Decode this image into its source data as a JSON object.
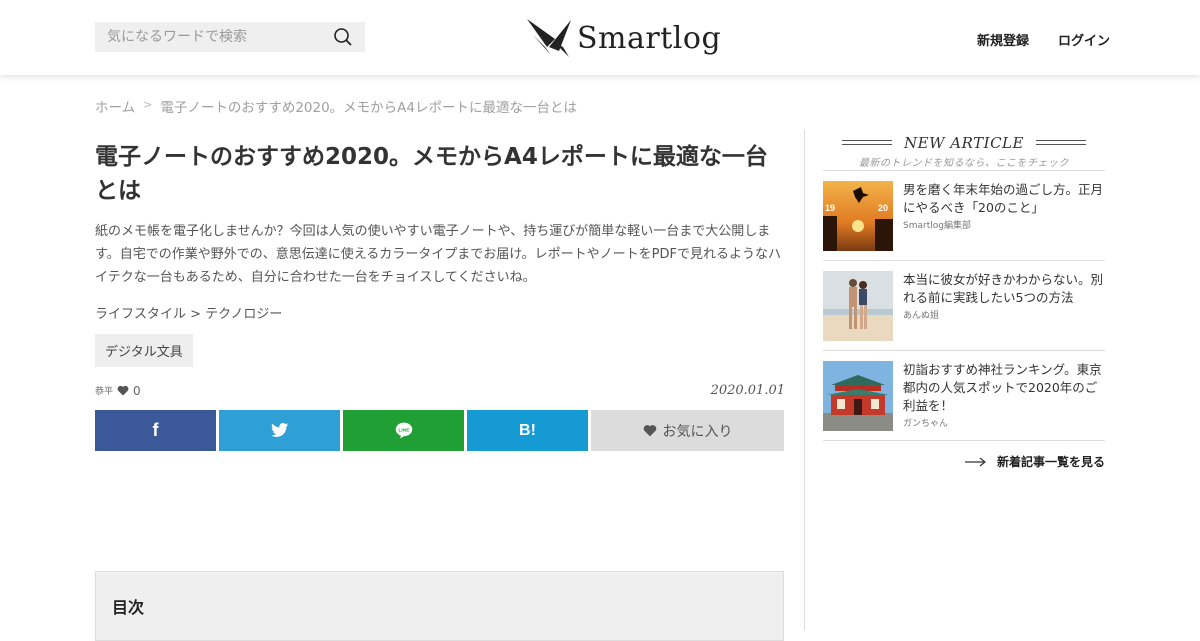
{
  "header": {
    "search_placeholder": "気になるワードで検索",
    "logo_text": "Smartlog",
    "register_label": "新規登録",
    "login_label": "ログイン"
  },
  "breadcrumb": {
    "home": "ホーム",
    "separator": ">",
    "current": "電子ノートのおすすめ2020。メモからA4レポートに最適な一台とは"
  },
  "article": {
    "title": "電子ノートのおすすめ2020。メモからA4レポートに最適な一台とは",
    "description": "紙のメモ帳を電子化しませんか？今回は人気の使いやすい電子ノートや、持ち運びが簡単な軽い一台まで大公開します。自宅での作業や野外での、意思伝達に使えるカラータイプまでお届け。レポートやノートをPDFで見れるようなハイテクな一台もあるため、自分に合わせた一台をチョイスしてくださいね。",
    "category": "ライフスタイル > テクノロジー",
    "tag": "デジタル文具",
    "author_short": "恭平",
    "like_count": "0",
    "date": "2020.01.01"
  },
  "share": {
    "facebook_icon": "f",
    "hatena_label": "B!",
    "favorite_label": "お気に入り"
  },
  "toc": {
    "title": "目次"
  },
  "sidebar": {
    "heading_en": "NEW ARTICLE",
    "heading_jp": "最新のトレンドを知るなら、ここをチェック",
    "articles": [
      {
        "title": "男を磨く年末年始の過ごし方。正月にやるべき「20のこと」",
        "author": "Smartlog編集部",
        "thumb": "sunset-2020-jump"
      },
      {
        "title": "本当に彼女が好きかわからない。別れる前に実践したい5つの方法",
        "author": "あんぬ姐",
        "thumb": "couple-on-beach"
      },
      {
        "title": "初詣おすすめ神社ランキング。東京都内の人気スポットで2020年のご利益を！",
        "author": "ガンちゃん",
        "thumb": "red-shrine-gate"
      }
    ],
    "more_label": "新着記事一覧を見る"
  },
  "colors": {
    "facebook": "#3b5998",
    "twitter": "#2ea0d6",
    "line": "#1f9f34",
    "hatena": "#169ad3",
    "favorite": "#dcdcdc"
  }
}
